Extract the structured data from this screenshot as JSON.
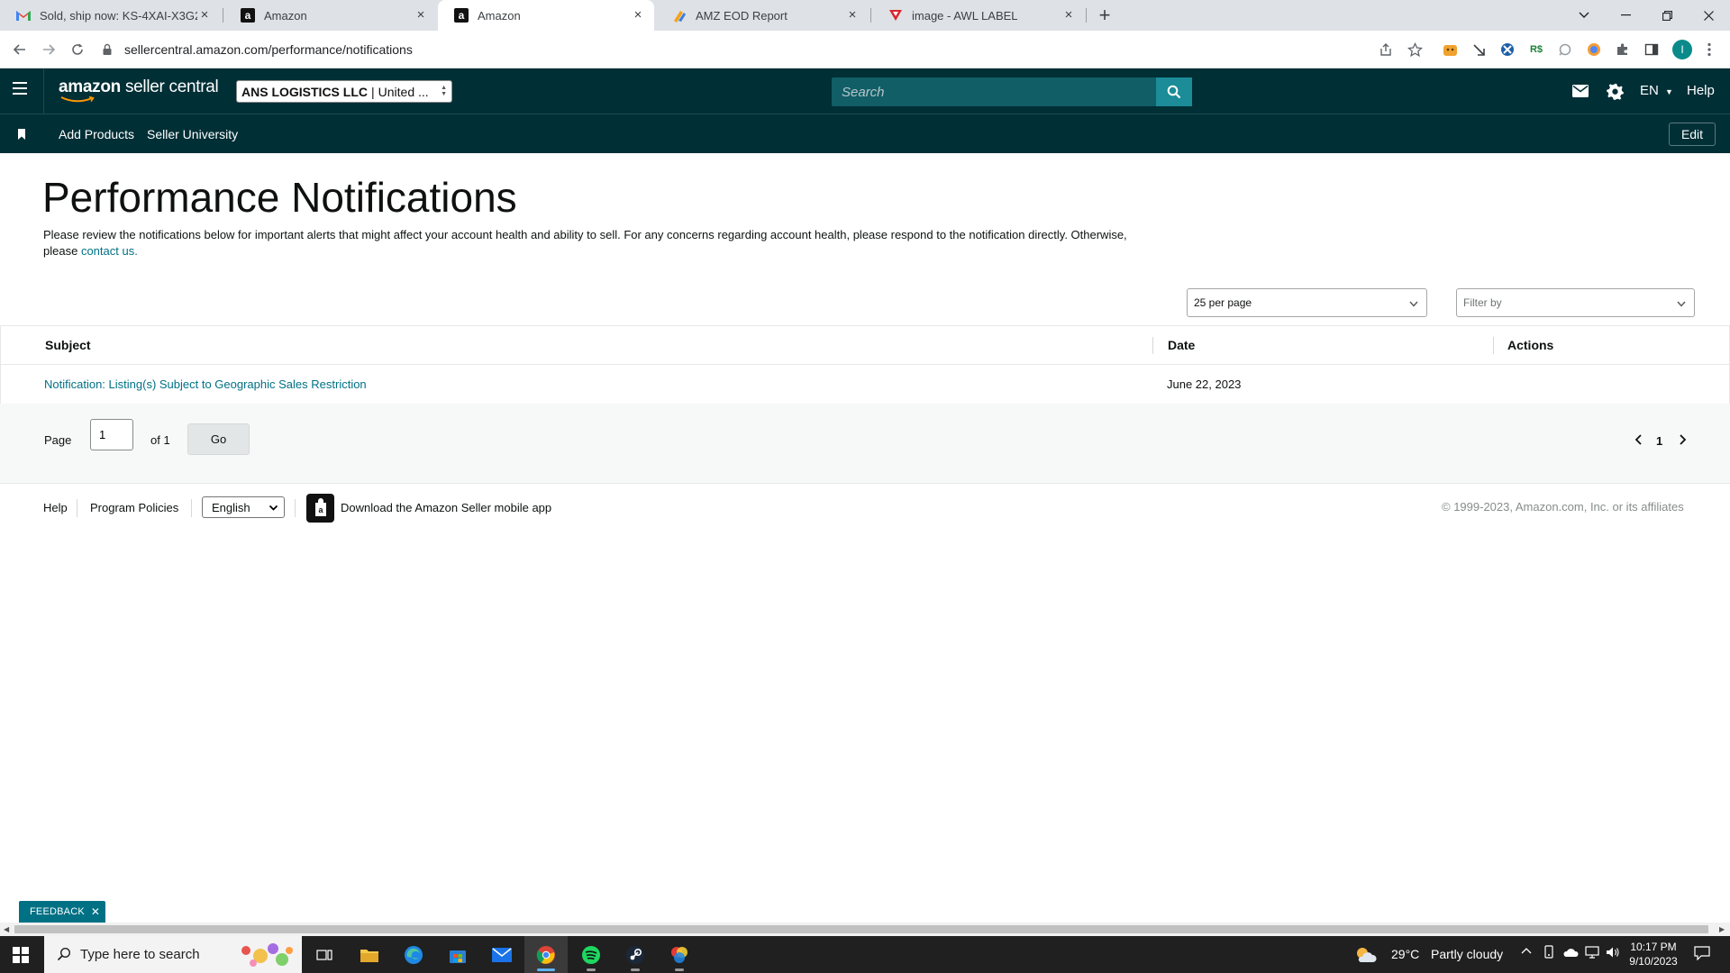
{
  "browser": {
    "tabs": [
      {
        "title": "Sold, ship now: KS-4XAI-X3G2 St",
        "icon": "gmail-icon",
        "active": false
      },
      {
        "title": "Amazon",
        "icon": "amazon-icon",
        "active": false
      },
      {
        "title": "Amazon",
        "icon": "amazon-icon",
        "active": true
      },
      {
        "title": "AMZ EOD Report",
        "icon": "report-icon",
        "active": false
      },
      {
        "title": "image - AWL LABEL",
        "icon": "label-icon",
        "active": false
      }
    ],
    "url": "sellercentral.amazon.com/performance/notifications",
    "profile_initial": "I",
    "extension_colors": {
      "profile": "#0a8a8a"
    }
  },
  "header": {
    "logo_brand": "amazon",
    "logo_product": "seller central",
    "account_name": "ANS LOGISTICS LLC",
    "account_region": "United ...",
    "search_placeholder": "Search",
    "language": "EN",
    "help_label": "Help"
  },
  "bookmarks": {
    "items": [
      "Add Products",
      "Seller University"
    ],
    "edit_label": "Edit"
  },
  "page": {
    "title": "Performance Notifications",
    "intro_text": "Please review the notifications below for important alerts that might affect your account health and ability to sell. For any concerns regarding account health, please respond to the notification directly. Otherwise, please",
    "contact_link": "contact us.",
    "per_page_value": "25 per page",
    "filter_placeholder": "Filter by"
  },
  "table": {
    "columns": [
      "Subject",
      "Date",
      "Actions"
    ],
    "rows": [
      {
        "subject": "Notification: Listing(s) Subject to Geographic Sales Restriction",
        "date": "June 22, 2023",
        "actions": ""
      }
    ]
  },
  "pagination": {
    "page_label": "Page",
    "current_page": "1",
    "of_label": "of 1",
    "go_label": "Go",
    "page_number": "1"
  },
  "footer": {
    "help_label": "Help",
    "policies_label": "Program Policies",
    "language_value": "English",
    "app_label": "Download the Amazon Seller mobile app",
    "copyright": "© 1999-2023, Amazon.com, Inc. or its affiliates"
  },
  "feedback_label": "FEEDBACK",
  "taskbar": {
    "search_placeholder": "Type here to search",
    "weather_temp": "29°C",
    "weather_desc": "Partly cloudy",
    "time": "10:17 PM",
    "date": "9/10/2023"
  },
  "colors": {
    "header_bg": "#002f36",
    "link": "#007185",
    "search_btn": "#1b8c98"
  }
}
